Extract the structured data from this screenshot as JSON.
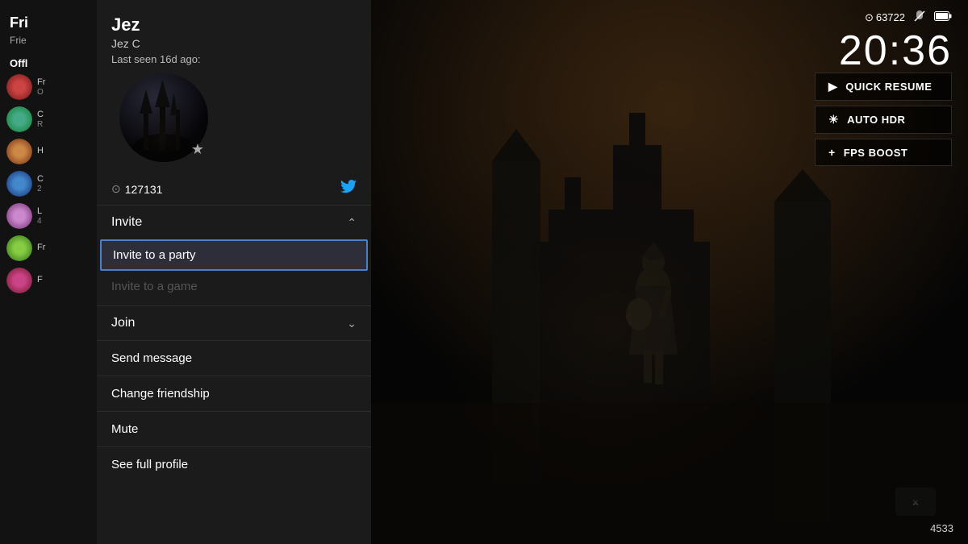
{
  "hud": {
    "gamerscore_label": "63722",
    "time": "20:36",
    "gamerscore_icon": "⊙",
    "mute_icon": "🔕",
    "battery_icon": "🔋"
  },
  "quick_menu": {
    "quick_resume": "QUICK RESUME",
    "auto_hdr": "AUTO HDR",
    "fps_boost": "FPS BOOST"
  },
  "sidebar": {
    "title": "Fri",
    "subtitle": "Frie",
    "section_offline": "Offl",
    "items": [
      {
        "name": "Fr",
        "status": "O"
      },
      {
        "name": "C",
        "status": "R"
      },
      {
        "name": "H",
        "status": ""
      },
      {
        "name": "C",
        "status": "2"
      },
      {
        "name": "L",
        "status": "4"
      },
      {
        "name": "Fr",
        "status": ""
      },
      {
        "name": "F",
        "status": ""
      }
    ]
  },
  "profile": {
    "name": "Jez",
    "gamertag": "Jez C",
    "last_seen": "Last seen 16d ago:",
    "gamerscore": "127131",
    "gamerscore_prefix": "G",
    "star": "★"
  },
  "menu": {
    "invite_label": "Invite",
    "invite_to_party": "Invite to a party",
    "invite_to_game": "Invite to a game",
    "join_label": "Join",
    "send_message": "Send message",
    "change_friendship": "Change friendship",
    "mute": "Mute",
    "see_full_profile": "See full profile"
  },
  "bottom": {
    "number": "4533"
  },
  "colors": {
    "accent_blue": "#4a80c4",
    "twitter_blue": "#1da1f2",
    "disabled_text": "#555555",
    "selected_border": "#4a80c4"
  }
}
